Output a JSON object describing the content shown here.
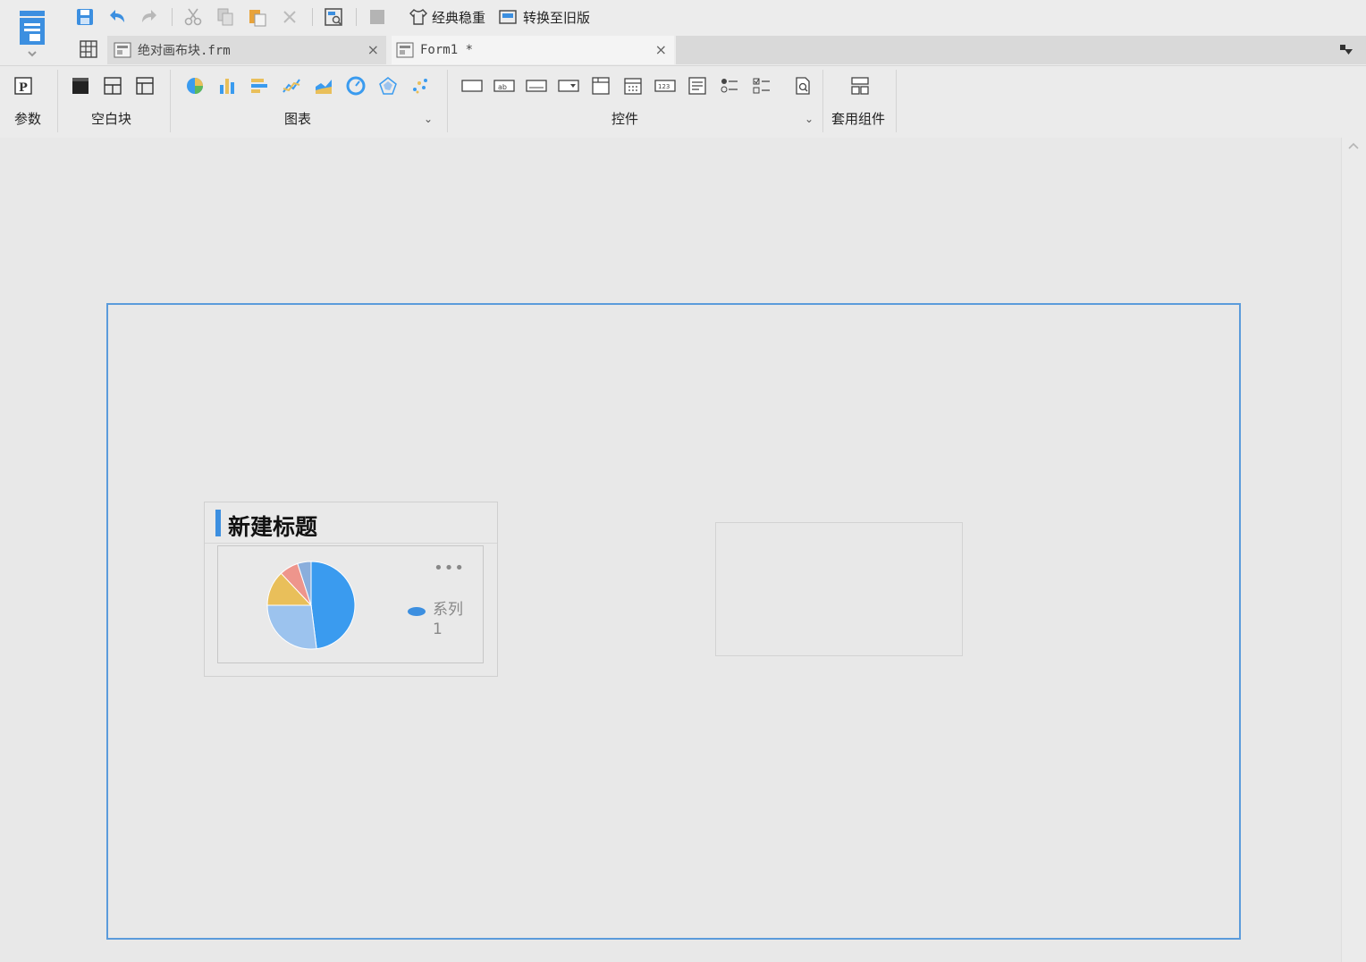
{
  "quick_access": {
    "style_label": "经典稳重",
    "convert_label": "转换至旧版"
  },
  "tabs": [
    {
      "label": "绝对画布块.frm",
      "active": false
    },
    {
      "label": "Form1 *",
      "active": true
    }
  ],
  "tab_close_glyph": "×",
  "ribbon": {
    "params_label": "参数",
    "blank_block_label": "空白块",
    "chart_label": "图表",
    "controls_label": "控件",
    "templates_label": "套用组件",
    "expand_glyph": "⌄"
  },
  "chart_widget": {
    "title": "新建标题",
    "more_glyph": "•••",
    "legend": "系列1"
  },
  "chart_data": {
    "type": "pie",
    "categories": [
      "",
      "",
      "",
      ""
    ],
    "values": [
      48,
      27,
      13,
      7
    ],
    "series": [
      {
        "name": "系列1",
        "values": [
          48,
          27,
          13,
          7
        ]
      }
    ],
    "title": "新建标题",
    "legend_position": "right",
    "colors": [
      "#3a9bef",
      "#9cc3ee",
      "#e9bf5a",
      "#ee958c",
      "#8aaedc"
    ]
  },
  "colors": {
    "accent": "#3c8fe0",
    "frame": "#5b9bdb"
  }
}
